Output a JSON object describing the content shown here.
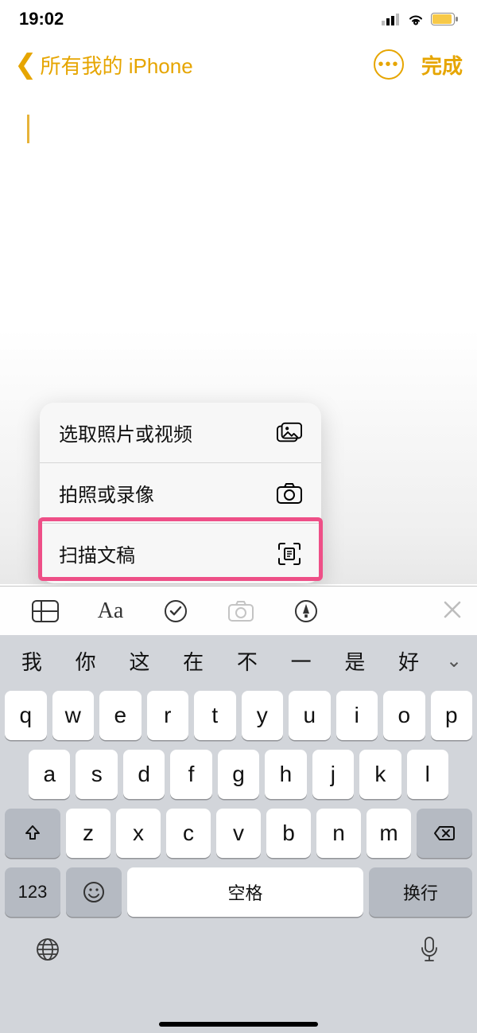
{
  "status": {
    "time": "19:02"
  },
  "nav": {
    "back_label": "所有我的 iPhone",
    "done_label": "完成"
  },
  "popup": {
    "items": [
      {
        "label": "选取照片或视频",
        "icon": "gallery"
      },
      {
        "label": "拍照或录像",
        "icon": "camera"
      },
      {
        "label": "扫描文稿",
        "icon": "scan"
      }
    ]
  },
  "toolbar": {
    "aa_label": "Aa"
  },
  "keyboard": {
    "candidates": [
      "我",
      "你",
      "这",
      "在",
      "不",
      "一",
      "是",
      "好"
    ],
    "row1": [
      "q",
      "w",
      "e",
      "r",
      "t",
      "y",
      "u",
      "i",
      "o",
      "p"
    ],
    "row2": [
      "a",
      "s",
      "d",
      "f",
      "g",
      "h",
      "j",
      "k",
      "l"
    ],
    "row3": [
      "z",
      "x",
      "c",
      "v",
      "b",
      "n",
      "m"
    ],
    "numkey": "123",
    "space": "空格",
    "return": "换行"
  }
}
